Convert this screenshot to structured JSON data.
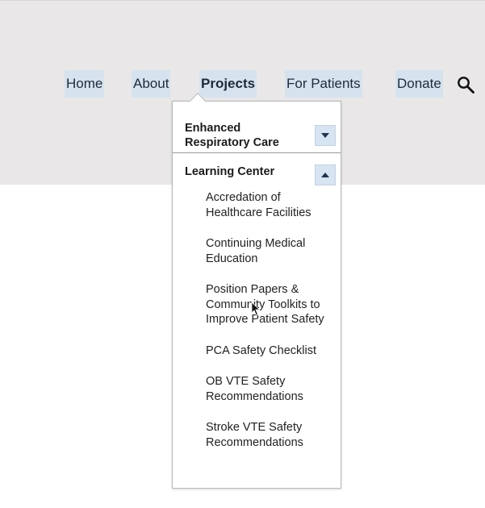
{
  "nav": {
    "items": [
      {
        "label": "Home"
      },
      {
        "label": "About"
      },
      {
        "label": "Projects"
      },
      {
        "label": "For Patients"
      },
      {
        "label": "Donate"
      }
    ],
    "search_icon": "search-icon"
  },
  "dropdown": {
    "sections": [
      {
        "title": "Enhanced Respiratory Care",
        "toggle_icon": "chevron-down-icon"
      },
      {
        "title": "Learning Center",
        "toggle_icon": "chevron-up-icon"
      }
    ],
    "learning_center_items": [
      {
        "label": "Accredation of Healthcare Facilities"
      },
      {
        "label": "Continuing Medical Education"
      },
      {
        "label": "Position Papers & Community Toolkits to Improve Patient Safety"
      },
      {
        "label": "PCA Safety Checklist"
      },
      {
        "label": "OB VTE Safety Recommendations"
      },
      {
        "label": "Stroke VTE Safety Recommendations"
      }
    ]
  },
  "colors": {
    "header_bg": "#e9e7e8",
    "nav_highlight": "#d6e3ef",
    "nav_text": "#1d2b3a",
    "toggle_bg": "#d7e4f1"
  }
}
